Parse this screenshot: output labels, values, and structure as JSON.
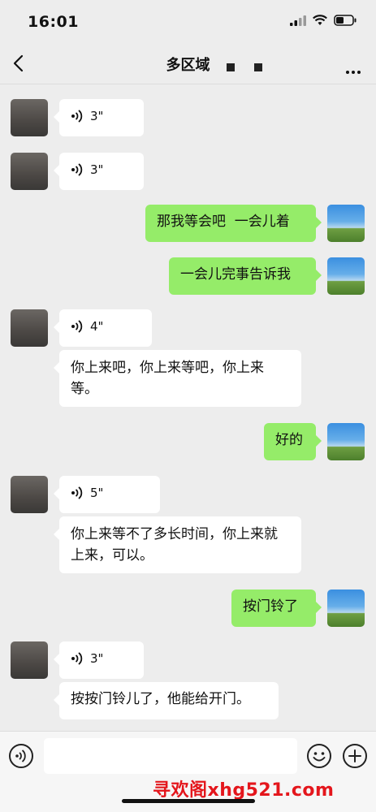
{
  "status_bar": {
    "time": "16:01"
  },
  "nav": {
    "title": "多区域"
  },
  "messages": [
    {
      "side": "left",
      "type": "voice",
      "duration": "3\""
    },
    {
      "side": "left",
      "type": "voice",
      "duration": "3\""
    },
    {
      "side": "right",
      "type": "text",
      "text": "那我等会吧  一会儿着"
    },
    {
      "side": "right",
      "type": "text",
      "text": "一会儿完事告诉我"
    },
    {
      "side": "left",
      "type": "voice",
      "duration": "4\""
    },
    {
      "side": "left",
      "type": "text",
      "text": "你上来吧，你上来等吧，你上来等。"
    },
    {
      "side": "right",
      "type": "text",
      "text": "好的"
    },
    {
      "side": "left",
      "type": "voice",
      "duration": "5\""
    },
    {
      "side": "left",
      "type": "text",
      "text": "你上来等不了多长时间，你上来就上来，可以。"
    },
    {
      "side": "right",
      "type": "text",
      "text": "按门铃了"
    },
    {
      "side": "left",
      "type": "voice",
      "duration": "3\""
    },
    {
      "side": "left",
      "type": "text",
      "text": "按按门铃儿了，他能给开门。"
    }
  ],
  "input": {
    "placeholder": ""
  },
  "watermark": "寻欢阁xhg521.com"
}
